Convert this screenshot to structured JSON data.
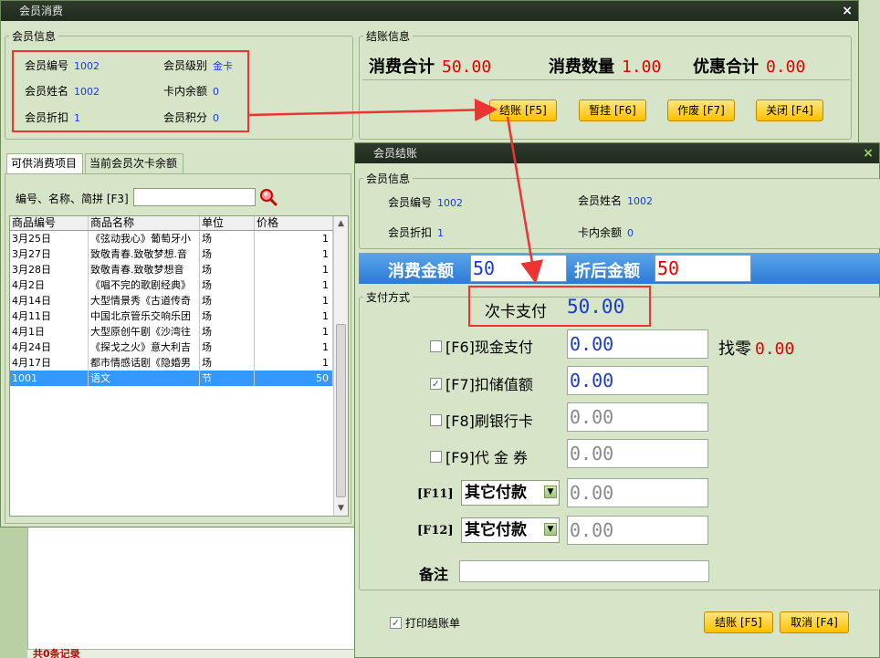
{
  "window1": {
    "title": "会员消费",
    "close_glyph": "×",
    "member_info": {
      "legend": "会员信息",
      "fields": [
        {
          "label": "会员编号",
          "value": "1002"
        },
        {
          "label": "会员级别",
          "value": "金卡"
        },
        {
          "label": "会员姓名",
          "value": "1002"
        },
        {
          "label": "卡内余额",
          "value": "0"
        },
        {
          "label": "会员折扣",
          "value": "1"
        },
        {
          "label": "会员积分",
          "value": "0"
        }
      ]
    },
    "checkout_info": {
      "legend": "结账信息",
      "total_label": "消费合计",
      "total_value": "50.00",
      "qty_label": "消费数量",
      "qty_value": "1.00",
      "discount_label": "优惠合计",
      "discount_value": "0.00"
    },
    "buttons": {
      "checkout": "结账 [F5]",
      "hold": "暂挂 [F6]",
      "void": "作废 [F7]",
      "close": "关闭 [F4]"
    },
    "tabs": [
      "可供消费项目",
      "当前会员次卡余额"
    ],
    "search_label": "编号、名称、简拼 [F3]",
    "table": {
      "headers": [
        "商品编号",
        "商品名称",
        "单位",
        "价格"
      ],
      "rows": [
        [
          "3月25日",
          "《弦动我心》葡萄牙小",
          "场",
          "1"
        ],
        [
          "3月27日",
          "致敬青春.致敬梦想.音",
          "场",
          "1"
        ],
        [
          "3月28日",
          "致敬青春.致敬梦想音",
          "场",
          "1"
        ],
        [
          "4月2日",
          "《唱不完的歌剧经典》",
          "场",
          "1"
        ],
        [
          "4月14日",
          "大型情景秀《古道传奇",
          "场",
          "1"
        ],
        [
          "4月11日",
          "中国北京管乐交响乐团",
          "场",
          "1"
        ],
        [
          "4月1日",
          "大型原创午剧《沙湾往",
          "场",
          "1"
        ],
        [
          "4月24日",
          "《探戈之火》意大利吉",
          "场",
          "1"
        ],
        [
          "4月17日",
          "都市情感话剧《隐婚男",
          "场",
          "1"
        ],
        [
          "1001",
          "语文",
          "节",
          "50"
        ]
      ],
      "selected_index": 9
    },
    "record_count": "共0条记录"
  },
  "window2": {
    "title": "会员结账",
    "close_glyph": "×",
    "member_info": {
      "legend": "会员信息",
      "fields": [
        {
          "label": "会员编号",
          "value": "1002"
        },
        {
          "label": "会员姓名",
          "value": "1002"
        },
        {
          "label": "会员折扣",
          "value": "1"
        },
        {
          "label": "卡内余额",
          "value": "0"
        }
      ]
    },
    "amount_label": "消费金额",
    "amount_value": "50",
    "after_discount_label": "折后金额",
    "after_discount_value": "50",
    "payment": {
      "legend": "支付方式",
      "card_pay_label": "次卡支付",
      "card_pay_value": "50.00",
      "change_label": "找零",
      "change_value": "0.00",
      "methods": [
        {
          "label": "[F6]现金支付",
          "value": "0.00",
          "checked": false,
          "enabled": true
        },
        {
          "label": "[F7]扣储值额",
          "value": "0.00",
          "checked": true,
          "enabled": true
        },
        {
          "label": "[F8]刷银行卡",
          "value": "0.00",
          "checked": false,
          "enabled": false
        },
        {
          "label": "[F9]代 金 券",
          "value": "0.00",
          "checked": false,
          "enabled": false
        }
      ],
      "other": [
        {
          "key": "[F11]",
          "select": "其它付款",
          "value": "0.00"
        },
        {
          "key": "[F12]",
          "select": "其它付款",
          "value": "0.00"
        }
      ],
      "memo_label": "备注"
    },
    "print_label": "打印结账单",
    "print_checked": true,
    "buttons": {
      "checkout": "结账 [F5]",
      "cancel": "取消 [F4]"
    }
  },
  "colors": {
    "accent_red": "#ee3333",
    "value_blue": "#1a3ccc",
    "button_gold": "#ffc000",
    "amount_bar": "#3a8be0"
  }
}
